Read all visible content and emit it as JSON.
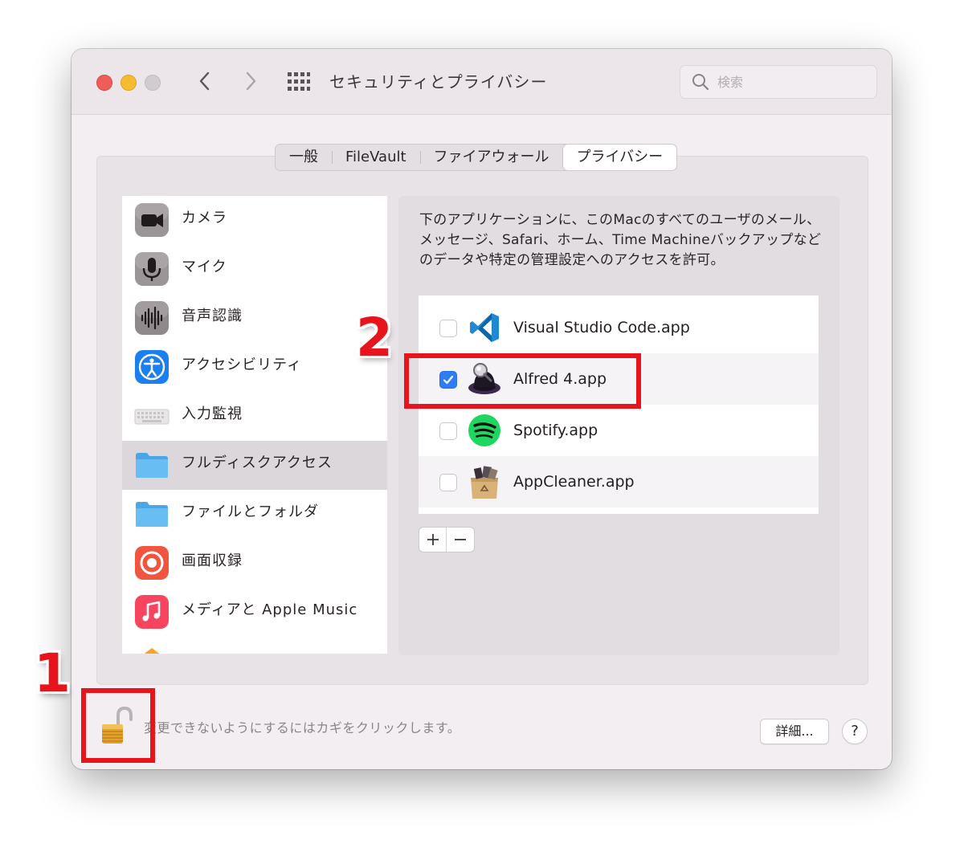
{
  "window": {
    "title": "セキュリティとプライバシー",
    "search_placeholder": "検索"
  },
  "tabs": [
    {
      "label": "一般",
      "active": false
    },
    {
      "label": "FileVault",
      "active": false
    },
    {
      "label": "ファイアウォール",
      "active": false
    },
    {
      "label": "プライバシー",
      "active": true
    }
  ],
  "sidebar": {
    "items": [
      {
        "label": "カメラ",
        "icon": "camera-icon"
      },
      {
        "label": "マイク",
        "icon": "microphone-icon"
      },
      {
        "label": "音声認識",
        "icon": "waveform-icon"
      },
      {
        "label": "アクセシビリティ",
        "icon": "accessibility-icon"
      },
      {
        "label": "入力監視",
        "icon": "keyboard-icon"
      },
      {
        "label": "フルディスクアクセス",
        "icon": "folder-icon",
        "selected": true
      },
      {
        "label": "ファイルとフォルダ",
        "icon": "folder-icon"
      },
      {
        "label": "画面収録",
        "icon": "screen-record-icon"
      },
      {
        "label": "メディアと Apple Music",
        "icon": "music-icon"
      }
    ]
  },
  "panel": {
    "description": "下のアプリケーションに、このMacのすべてのユーザのメール、メッセージ、Safari、ホーム、Time Machineバックアップなどのデータや特定の管理設定へのアクセスを許可。",
    "apps": [
      {
        "name": "Visual Studio Code.app",
        "checked": false,
        "icon": "vscode-icon"
      },
      {
        "name": "Alfred 4.app",
        "checked": true,
        "icon": "alfred-icon"
      },
      {
        "name": "Spotify.app",
        "checked": false,
        "icon": "spotify-icon"
      },
      {
        "name": "AppCleaner.app",
        "checked": false,
        "icon": "appcleaner-icon"
      }
    ],
    "add_label": "+",
    "remove_label": "−"
  },
  "footer": {
    "lock_text": "変更できないようにするにはカギをクリックします。",
    "details_label": "詳細...",
    "help_label": "?"
  },
  "annotations": {
    "step1": "1",
    "step2": "2"
  },
  "colors": {
    "highlight": "#e8141c",
    "checkbox_checked": "#2f7cf6"
  }
}
